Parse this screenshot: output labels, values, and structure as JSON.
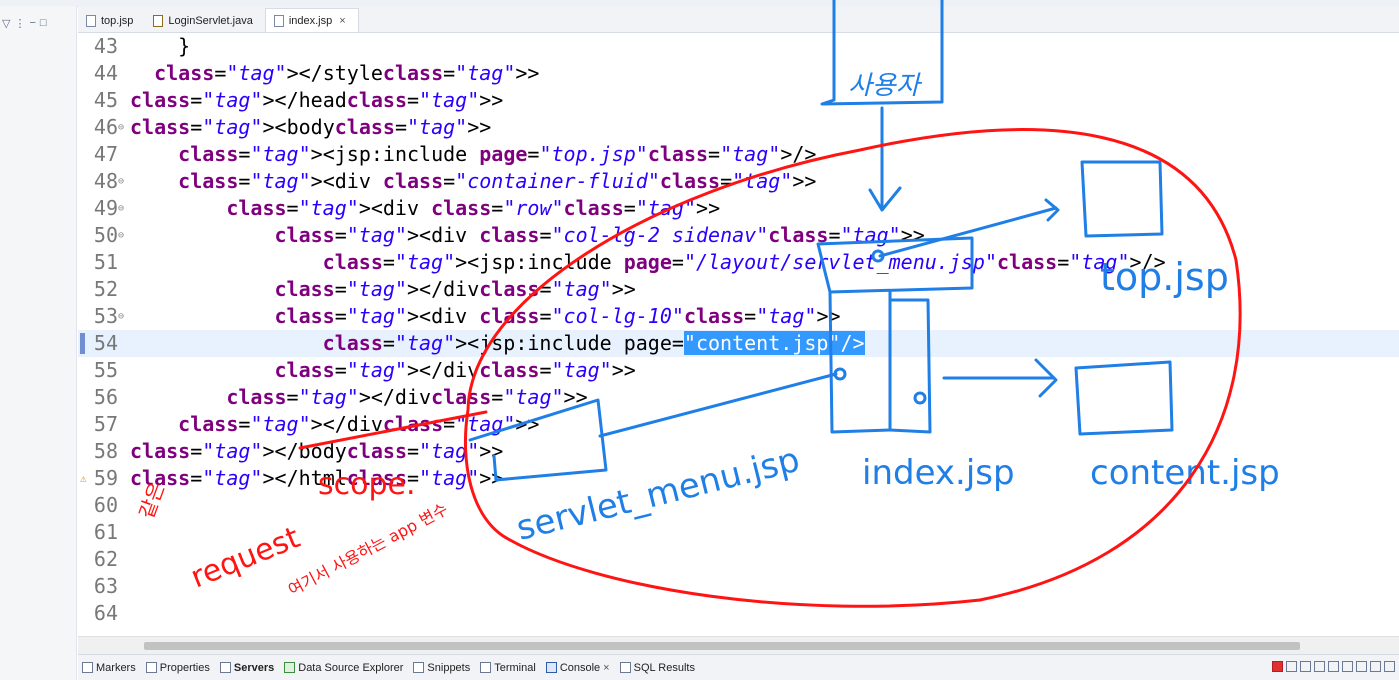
{
  "editor_tabs": [
    {
      "label": "top.jsp",
      "icon": "jsp-file-icon",
      "active": false
    },
    {
      "label": "LoginServlet.java",
      "icon": "java-file-icon",
      "active": false
    },
    {
      "label": "index.jsp",
      "icon": "jsp-file-icon",
      "active": true,
      "close": "×"
    }
  ],
  "code_lines": [
    {
      "n": "43",
      "text": "    }"
    },
    {
      "n": "44",
      "text": "  </style>"
    },
    {
      "n": "45",
      "text": "</head>"
    },
    {
      "n": "46",
      "text": "<body>"
    },
    {
      "n": "47",
      "text": "    <jsp:include page=\"top.jsp\"/>"
    },
    {
      "n": "48",
      "text": "    <div class=\"container-fluid\">"
    },
    {
      "n": "49",
      "text": "        <div class=\"row\">"
    },
    {
      "n": "50",
      "text": "            <div class=\"col-lg-2 sidenav\">"
    },
    {
      "n": "51",
      "text": "                <jsp:include page=\"/layout/servlet_menu.jsp\"/>"
    },
    {
      "n": "52",
      "text": "            </div>"
    },
    {
      "n": "53",
      "text": "            <div class=\"col-lg-10\">"
    },
    {
      "n": "54",
      "text": "                <jsp:include page=\"content.jsp\"/>"
    },
    {
      "n": "55",
      "text": "            </div>"
    },
    {
      "n": "56",
      "text": "        </div>"
    },
    {
      "n": "57",
      "text": "    </div>"
    },
    {
      "n": "58",
      "text": "</body>"
    },
    {
      "n": "59",
      "text": "</html>"
    },
    {
      "n": "60",
      "text": ""
    },
    {
      "n": "61",
      "text": ""
    },
    {
      "n": "62",
      "text": ""
    },
    {
      "n": "63",
      "text": ""
    },
    {
      "n": "64",
      "text": ""
    }
  ],
  "current_line": "54",
  "selected_text": "\"content.jsp\"/>",
  "bottom_views": [
    {
      "label": "Markers",
      "icon": "markers-icon"
    },
    {
      "label": "Properties",
      "icon": "properties-icon"
    },
    {
      "label": "Servers",
      "icon": "servers-icon",
      "bold": true
    },
    {
      "label": "Data Source Explorer",
      "icon": "data-source-icon"
    },
    {
      "label": "Snippets",
      "icon": "snippets-icon"
    },
    {
      "label": "Terminal",
      "icon": "terminal-icon"
    },
    {
      "label": "Console",
      "icon": "console-icon",
      "close": "×"
    },
    {
      "label": "SQL Results",
      "icon": "sql-results-icon"
    }
  ],
  "annotations": {
    "blue_color": "#1f7fe6",
    "red_color": "#ff1414",
    "labels": {
      "top_box": "사용자",
      "top_jsp": "top.jsp",
      "index_jsp": "index.jsp",
      "content_jsp": "content.jsp",
      "servlet_menu": "servlet_menu.jsp",
      "scope": "scope.",
      "request": "request",
      "note_a": "같은",
      "note_b": "여기서 사용하는 app 변수"
    }
  },
  "colors": {
    "tag": "#17176b",
    "attribute": "#7f007f",
    "value": "#2a00ff",
    "selection": "#3399ff",
    "current_line_bg": "#e8f2fe"
  }
}
